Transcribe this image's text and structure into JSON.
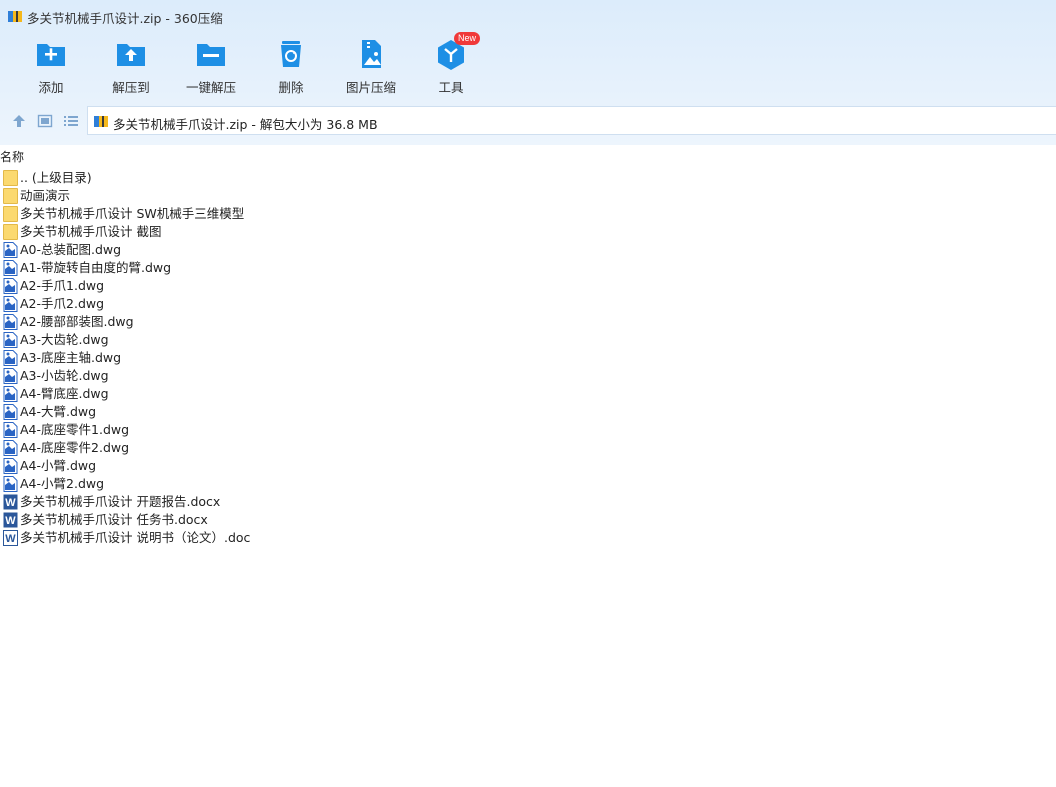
{
  "window": {
    "title": "多关节机械手爪设计.zip - 360压缩"
  },
  "toolbar": {
    "buttons": [
      {
        "label": "添加",
        "icon": "add-icon"
      },
      {
        "label": "解压到",
        "icon": "extract-to-icon"
      },
      {
        "label": "一键解压",
        "icon": "one-click-extract-icon"
      },
      {
        "label": "删除",
        "icon": "recycle-delete-icon"
      },
      {
        "label": "图片压缩",
        "icon": "image-compress-icon"
      },
      {
        "label": "工具",
        "icon": "tools-icon"
      }
    ],
    "new_badge": "New"
  },
  "nav": {
    "address": "多关节机械手爪设计.zip - 解包大小为 36.8 MB"
  },
  "columns": {
    "name": "名称"
  },
  "files": [
    {
      "name": ".. (上级目录)",
      "type": "folder"
    },
    {
      "name": "动画演示",
      "type": "folder"
    },
    {
      "name": "多关节机械手爪设计 SW机械手三维模型",
      "type": "folder"
    },
    {
      "name": "多关节机械手爪设计 截图",
      "type": "folder"
    },
    {
      "name": "A0-总装配图.dwg",
      "type": "dwg"
    },
    {
      "name": "A1-带旋转自由度的臂.dwg",
      "type": "dwg"
    },
    {
      "name": "A2-手爪1.dwg",
      "type": "dwg"
    },
    {
      "name": "A2-手爪2.dwg",
      "type": "dwg"
    },
    {
      "name": "A2-腰部部装图.dwg",
      "type": "dwg"
    },
    {
      "name": "A3-大齿轮.dwg",
      "type": "dwg"
    },
    {
      "name": "A3-底座主轴.dwg",
      "type": "dwg"
    },
    {
      "name": "A3-小齿轮.dwg",
      "type": "dwg"
    },
    {
      "name": "A4-臂底座.dwg",
      "type": "dwg"
    },
    {
      "name": "A4-大臂.dwg",
      "type": "dwg"
    },
    {
      "name": "A4-底座零件1.dwg",
      "type": "dwg"
    },
    {
      "name": "A4-底座零件2.dwg",
      "type": "dwg"
    },
    {
      "name": "A4-小臂.dwg",
      "type": "dwg"
    },
    {
      "name": "A4-小臂2.dwg",
      "type": "dwg"
    },
    {
      "name": "多关节机械手爪设计 开题报告.docx",
      "type": "docx"
    },
    {
      "name": "多关节机械手爪设计 任务书.docx",
      "type": "docx"
    },
    {
      "name": "多关节机械手爪设计 说明书（论文）.doc",
      "type": "doc"
    }
  ]
}
